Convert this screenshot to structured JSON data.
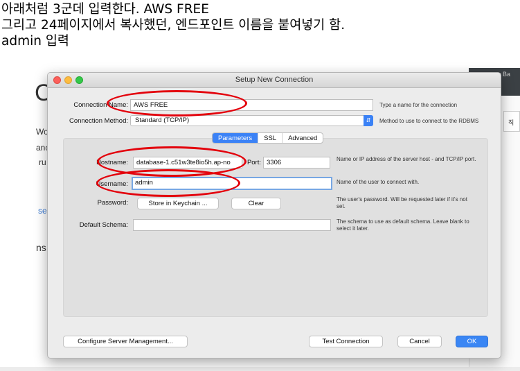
{
  "caption": {
    "line1": "아래처럼 3군데 입력한다. AWS FREE",
    "line2": "그리고 24페이지에서 복사했던, 엔드포인트 이름을 붙여넣기 함.",
    "line3": "admin 입력"
  },
  "background": {
    "big_letter": "C",
    "wor": "Wor",
    "anc": "anc",
    "ru": "ru",
    "se": "se",
    "ns": "ns",
    "right_top": "r Ba",
    "right_cell": "직"
  },
  "dialog": {
    "title": "Setup New Connection",
    "connection_name_label": "Connection Name:",
    "connection_name_value": "AWS FREE",
    "connection_name_hint": "Type a name for the connection",
    "connection_method_label": "Connection Method:",
    "connection_method_value": "Standard (TCP/IP)",
    "connection_method_hint": "Method to use to connect to the RDBMS",
    "tabs": [
      "Parameters",
      "SSL",
      "Advanced"
    ],
    "hostname_label": "Hostname:",
    "hostname_value": "database-1.c51w3te8io5h.ap-no",
    "port_label": "Port:",
    "port_value": "3306",
    "hostname_hint": "Name or IP address of the server host - and TCP/IP port.",
    "username_label": "Username:",
    "username_value": "admin",
    "username_hint": "Name of the user to connect with.",
    "password_label": "Password:",
    "store_keychain_label": "Store in Keychain ...",
    "clear_label": "Clear",
    "password_hint": "The user's password. Will be requested later if it's not set.",
    "default_schema_label": "Default Schema:",
    "default_schema_value": "",
    "default_schema_hint": "The schema to use as default schema. Leave blank to select it later.",
    "configure_label": "Configure Server Management...",
    "test_label": "Test Connection",
    "cancel_label": "Cancel",
    "ok_label": "OK"
  },
  "colors": {
    "accent": "#3a86f4",
    "annotation": "#e3000b"
  }
}
